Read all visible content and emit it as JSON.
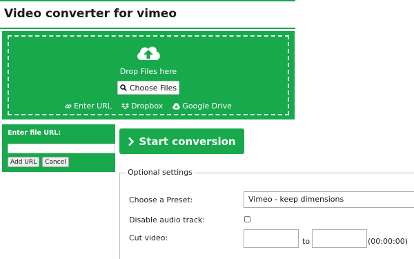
{
  "header": {
    "title": "Video converter for vimeo"
  },
  "upload": {
    "drop_text": "Drop Files here",
    "choose_files_label": "Choose Files",
    "sources": [
      {
        "icon": "link-icon",
        "label": "Enter URL"
      },
      {
        "icon": "dropbox-icon",
        "label": "Dropbox"
      },
      {
        "icon": "google-drive-icon",
        "label": "Google Drive"
      }
    ]
  },
  "url_panel": {
    "label": "Enter file URL:",
    "input_value": "",
    "add_url_label": "Add URL",
    "cancel_label": "Cancel"
  },
  "start_button": {
    "label": "Start conversion"
  },
  "optional_settings": {
    "legend": "Optional settings",
    "preset_label": "Choose a Preset:",
    "preset_value": "Vimeo - keep dimensions",
    "disable_audio_label": "Disable audio track:",
    "disable_audio_checked": false,
    "cut_video_label": "Cut video:",
    "cut_from_value": "",
    "cut_to_label": "to",
    "cut_to_value": "",
    "cut_format": "(00:00:00)"
  },
  "colors": {
    "accent": "#17a94c"
  }
}
